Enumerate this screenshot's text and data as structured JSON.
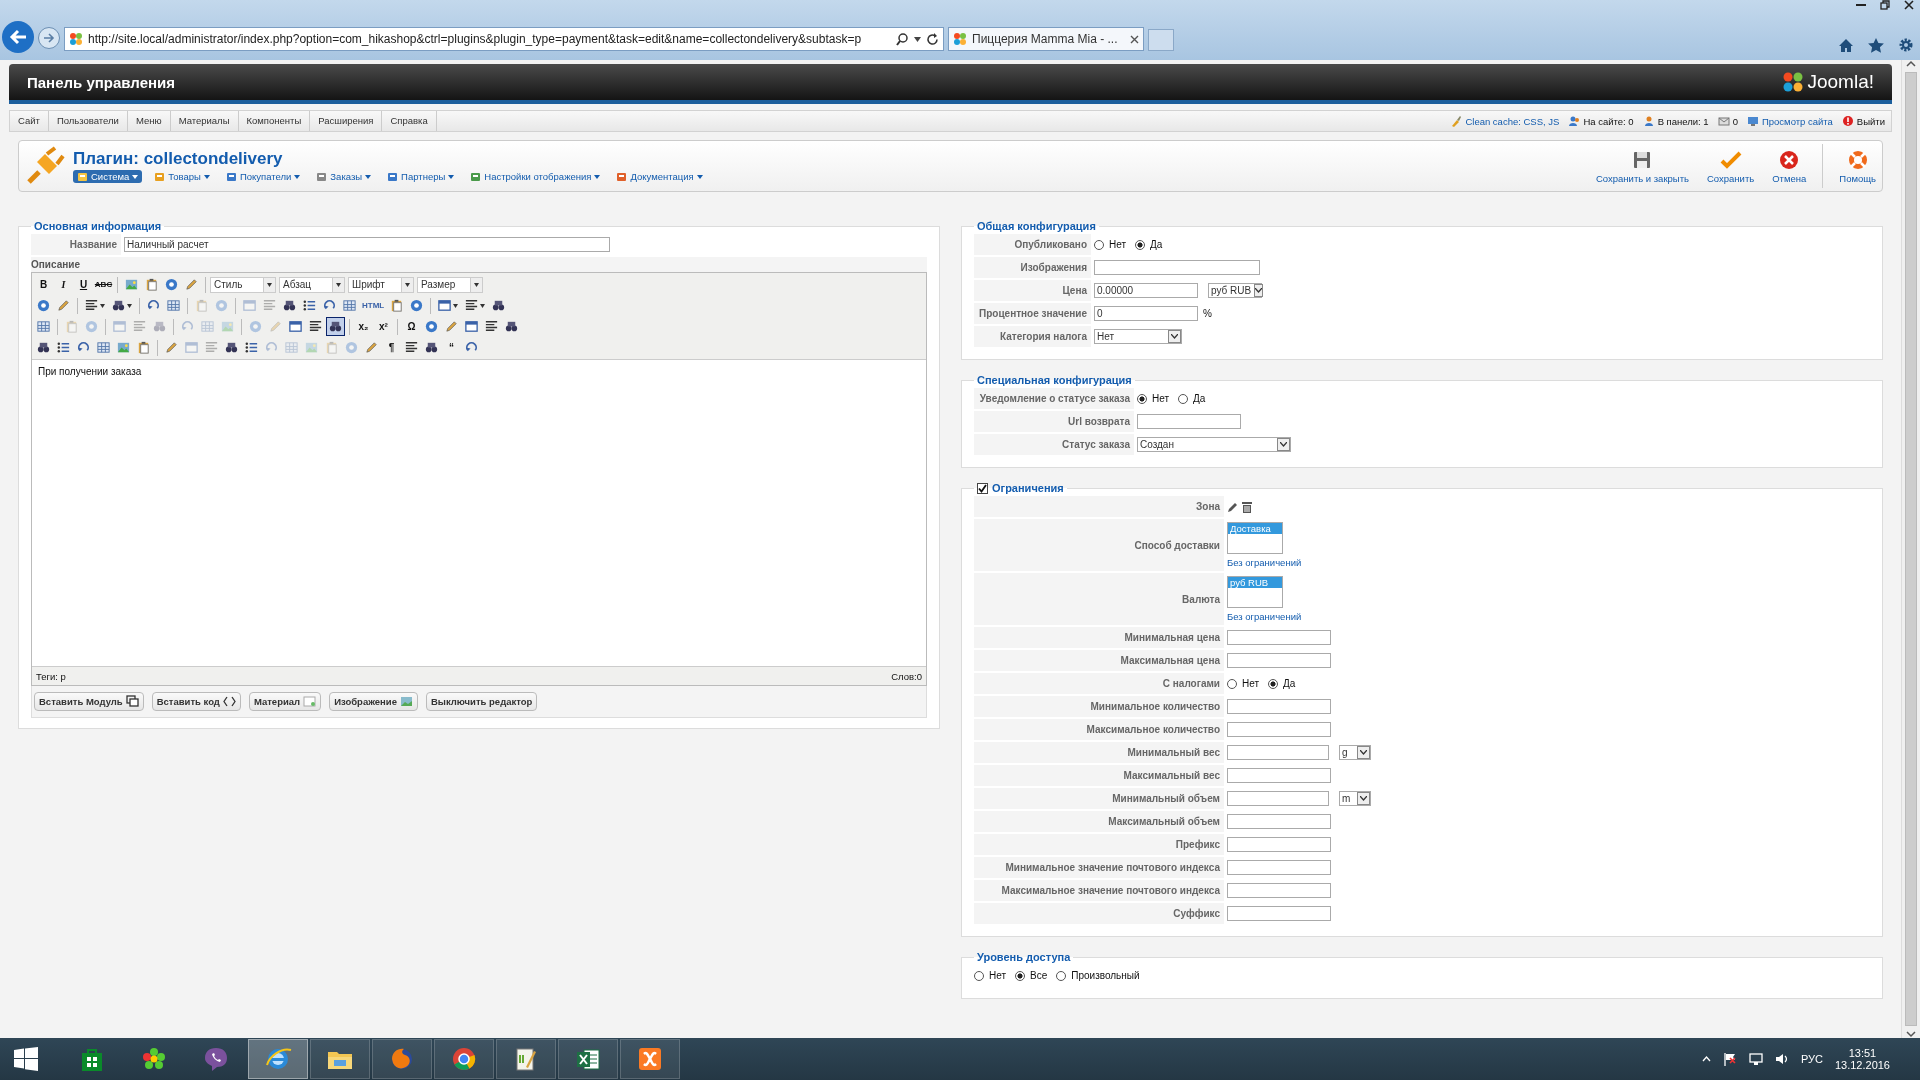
{
  "browser": {
    "url": "http://site.local/administrator/index.php?option=com_hikashop&ctrl=plugins&plugin_type=payment&task=edit&name=collectondelivery&subtask=p",
    "tabs": [
      {
        "title": "Пиццерия Mamma Mia - ...",
        "selected": true
      }
    ]
  },
  "header": {
    "title": "Панель управления",
    "logo": "Joomla!"
  },
  "menu": [
    "Сайт",
    "Пользователи",
    "Меню",
    "Материалы",
    "Компоненты",
    "Расширения",
    "Справка"
  ],
  "status_links": [
    {
      "kind": "cache",
      "label": "Clean cache: CSS, JS"
    },
    {
      "kind": "visitors",
      "label": "На сайте: 0"
    },
    {
      "kind": "admins",
      "label": "В панели: 1"
    },
    {
      "kind": "messages",
      "label": "0"
    },
    {
      "kind": "preview",
      "label": "Просмотр сайта"
    },
    {
      "kind": "logout",
      "label": "Выйти"
    }
  ],
  "toolbar": {
    "title": "Плагин: collectondelivery",
    "submenu": [
      {
        "label": "Система",
        "selected": true
      },
      {
        "label": "Товары",
        "selected": false
      },
      {
        "label": "Покупатели",
        "selected": false
      },
      {
        "label": "Заказы",
        "selected": false
      },
      {
        "label": "Партнеры",
        "selected": false
      },
      {
        "label": "Настройки отображения",
        "selected": false
      },
      {
        "label": "Документация",
        "selected": false
      }
    ],
    "buttons": [
      {
        "kind": "save_close",
        "label": "Сохранить и закрыть"
      },
      {
        "kind": "save",
        "label": "Сохранить"
      },
      {
        "kind": "cancel",
        "label": "Отмена"
      },
      {
        "kind": "help",
        "label": "Помощь"
      }
    ]
  },
  "basic": {
    "legend": "Основная информация",
    "name_label": "Название",
    "name_value": "Наличный расчет",
    "description_label": "Описание",
    "editor": {
      "tool_lines": [
        [
          {
            "kind": "bold",
            "text": "B"
          },
          {
            "kind": "italic",
            "text": "I"
          },
          {
            "kind": "underline",
            "text": "U"
          },
          {
            "kind": "strike",
            "text": "ABC"
          },
          {
            "kind": "sep"
          },
          {
            "kind": "icon",
            "disabled": false,
            "active": false
          },
          {
            "kind": "icon",
            "disabled": false,
            "active": false
          },
          {
            "kind": "icon",
            "disabled": false,
            "active": false
          },
          {
            "kind": "icon",
            "disabled": false,
            "active": false
          },
          {
            "kind": "sep"
          },
          {
            "kind": "select",
            "label": "Стиль"
          },
          {
            "kind": "select",
            "label": "Абзац"
          },
          {
            "kind": "select",
            "label": "Шрифт"
          },
          {
            "kind": "select",
            "label": "Размер"
          }
        ],
        [
          {
            "kind": "icon",
            "disabled": false,
            "active": false
          },
          {
            "kind": "icon",
            "disabled": false,
            "active": false
          },
          {
            "kind": "sep"
          },
          {
            "kind": "icon_menu",
            "disabled": false,
            "active": false
          },
          {
            "kind": "icon_menu",
            "disabled": false,
            "active": false
          },
          {
            "kind": "sep"
          },
          {
            "kind": "icon",
            "disabled": false,
            "active": false
          },
          {
            "kind": "icon",
            "disabled": false,
            "active": false
          },
          {
            "kind": "sep"
          },
          {
            "kind": "icon",
            "disabled": true,
            "active": false
          },
          {
            "kind": "icon",
            "disabled": true,
            "active": false
          },
          {
            "kind": "sep"
          },
          {
            "kind": "icon",
            "disabled": true,
            "active": false
          },
          {
            "kind": "icon",
            "disabled": true,
            "active": false
          },
          {
            "kind": "icon",
            "disabled": false,
            "active": false
          },
          {
            "kind": "icon",
            "disabled": false,
            "active": false
          },
          {
            "kind": "icon",
            "disabled": false,
            "active": false
          },
          {
            "kind": "icon",
            "disabled": false,
            "active": false
          },
          {
            "kind": "small",
            "text": "HTML"
          },
          {
            "kind": "icon",
            "disabled": false,
            "active": false
          },
          {
            "kind": "icon",
            "disabled": false,
            "active": false
          },
          {
            "kind": "sep"
          },
          {
            "kind": "icon_menu",
            "disabled": false,
            "active": false
          },
          {
            "kind": "icon_menu",
            "disabled": false,
            "active": false
          },
          {
            "kind": "icon",
            "disabled": false,
            "active": false
          }
        ],
        [
          {
            "kind": "icon",
            "disabled": false,
            "active": false
          },
          {
            "kind": "sep"
          },
          {
            "kind": "icon",
            "disabled": true,
            "active": false
          },
          {
            "kind": "icon",
            "disabled": true,
            "active": false
          },
          {
            "kind": "sep"
          },
          {
            "kind": "icon",
            "disabled": true,
            "active": false
          },
          {
            "kind": "icon",
            "disabled": true,
            "active": false
          },
          {
            "kind": "icon",
            "disabled": true,
            "active": false
          },
          {
            "kind": "sep"
          },
          {
            "kind": "icon",
            "disabled": true,
            "active": false
          },
          {
            "kind": "icon",
            "disabled": true,
            "active": false
          },
          {
            "kind": "icon",
            "disabled": true,
            "active": false
          },
          {
            "kind": "sep"
          },
          {
            "kind": "icon",
            "disabled": true,
            "active": false
          },
          {
            "kind": "icon",
            "disabled": true,
            "active": false
          },
          {
            "kind": "icon",
            "disabled": false,
            "active": false
          },
          {
            "kind": "icon",
            "disabled": false,
            "active": false
          },
          {
            "kind": "icon",
            "disabled": false,
            "active": true
          },
          {
            "kind": "sep"
          },
          {
            "kind": "glyph",
            "text": "x₂"
          },
          {
            "kind": "glyph",
            "text": "x²"
          },
          {
            "kind": "sep"
          },
          {
            "kind": "glyph",
            "text": "Ω"
          },
          {
            "kind": "icon",
            "disabled": false,
            "active": false
          },
          {
            "kind": "icon",
            "disabled": false,
            "active": false
          },
          {
            "kind": "icon",
            "disabled": false,
            "active": false
          },
          {
            "kind": "icon",
            "disabled": false,
            "active": false
          },
          {
            "kind": "icon",
            "disabled": false,
            "active": false
          }
        ],
        [
          {
            "kind": "icon",
            "disabled": false,
            "active": false
          },
          {
            "kind": "icon",
            "disabled": false,
            "active": false
          },
          {
            "kind": "icon",
            "disabled": false,
            "active": false
          },
          {
            "kind": "icon",
            "disabled": false,
            "active": false
          },
          {
            "kind": "icon",
            "disabled": false,
            "active": false
          },
          {
            "kind": "icon",
            "disabled": false,
            "active": false
          },
          {
            "kind": "sep"
          },
          {
            "kind": "icon",
            "disabled": false,
            "active": false
          },
          {
            "kind": "icon",
            "disabled": true,
            "active": false
          },
          {
            "kind": "icon",
            "disabled": true,
            "active": false
          },
          {
            "kind": "icon",
            "disabled": false,
            "active": false
          },
          {
            "kind": "icon",
            "disabled": false,
            "active": false
          },
          {
            "kind": "icon",
            "disabled": true,
            "active": false
          },
          {
            "kind": "icon",
            "disabled": true,
            "active": false
          },
          {
            "kind": "icon",
            "disabled": true,
            "active": false
          },
          {
            "kind": "icon",
            "disabled": true,
            "active": false
          },
          {
            "kind": "icon",
            "disabled": true,
            "active": false
          },
          {
            "kind": "icon",
            "disabled": false,
            "active": false
          },
          {
            "kind": "glyph",
            "text": "¶"
          },
          {
            "kind": "icon",
            "disabled": false,
            "active": false
          },
          {
            "kind": "icon",
            "disabled": false,
            "active": false
          },
          {
            "kind": "glyph",
            "text": "“"
          },
          {
            "kind": "icon",
            "disabled": false,
            "active": false
          }
        ]
      ],
      "content": "При получении заказа",
      "tags": "Теги: p",
      "words": "Слов:0"
    },
    "buttons": [
      {
        "kind": "module",
        "label": "Вставить Модуль"
      },
      {
        "kind": "code",
        "label": "Вставить код"
      },
      {
        "kind": "article",
        "label": "Материал"
      },
      {
        "kind": "image",
        "label": "Изображение"
      },
      {
        "kind": "plain",
        "label": "Выключить редактор"
      }
    ]
  },
  "sections": [
    {
      "kind": "general",
      "legend": "Общая конфигурация",
      "fields": [
        {
          "label": "Опубликовано",
          "kind": "radio",
          "options": [
            {
              "label": "Нет",
              "selected": false
            },
            {
              "label": "Да",
              "selected": true
            }
          ]
        },
        {
          "label": "Изображения",
          "kind": "input"
        },
        {
          "label": "Цена",
          "kind": "input_select",
          "value": "0.00000",
          "select": "руб RUB"
        },
        {
          "label": "Процентное значение",
          "kind": "input_suffix",
          "value": "0",
          "suffix": "%"
        },
        {
          "label": "Категория налога",
          "kind": "select",
          "value": "Нет"
        }
      ]
    },
    {
      "kind": "special",
      "legend": "Специальная конфигурация",
      "fields": [
        {
          "label": "Уведомление о статусе заказа",
          "kind": "radio",
          "options": [
            {
              "label": "Нет",
              "selected": true
            },
            {
              "label": "Да",
              "selected": false
            }
          ]
        },
        {
          "label": "Url возврата",
          "kind": "input"
        },
        {
          "label": "Статус заказа",
          "kind": "select",
          "value": "Создан"
        }
      ]
    },
    {
      "kind": "restrictions",
      "legend": "Ограничения",
      "checked": true,
      "fields": [
        {
          "label": "Зона",
          "kind": "icons"
        },
        {
          "label": "Способ доставки",
          "kind": "listbox",
          "options": [
            {
              "label": "Доставка",
              "selected": true
            }
          ],
          "link": "Без ограничений"
        },
        {
          "label": "Валюта",
          "kind": "listbox",
          "options": [
            {
              "label": "руб RUB",
              "selected": true
            }
          ],
          "link": "Без ограничений"
        },
        {
          "label": "Минимальная цена",
          "kind": "input"
        },
        {
          "label": "Максимальная цена",
          "kind": "input"
        },
        {
          "label": "С налогами",
          "kind": "radio",
          "options": [
            {
              "label": "Нет",
              "selected": false
            },
            {
              "label": "Да",
              "selected": true
            }
          ]
        },
        {
          "label": "Минимальное количество",
          "kind": "input"
        },
        {
          "label": "Максимальное количество",
          "kind": "input"
        },
        {
          "label": "Минимальный вес",
          "kind": "input_select",
          "select": "g"
        },
        {
          "label": "Максимальный вес",
          "kind": "input"
        },
        {
          "label": "Минимальный объем",
          "kind": "input_select",
          "select": "m"
        },
        {
          "label": "Максимальный объем",
          "kind": "input"
        },
        {
          "label": "Префикс",
          "kind": "input"
        },
        {
          "label": "Минимальное значение почтового индекса",
          "kind": "input"
        },
        {
          "label": "Максимальное значение почтового индекса",
          "kind": "input"
        },
        {
          "label": "Суффикс",
          "kind": "input"
        }
      ]
    }
  ],
  "access": {
    "legend": "Уровень доступа",
    "options": [
      {
        "label": "Нет",
        "selected": false
      },
      {
        "label": "Все",
        "selected": true
      },
      {
        "label": "Произвольный",
        "selected": false
      }
    ]
  },
  "taskbar": {
    "apps": [
      {
        "kind": "store",
        "selected": false
      },
      {
        "kind": "flower",
        "selected": false
      },
      {
        "kind": "chat",
        "selected": false
      },
      {
        "kind": "ie",
        "selected": true
      },
      {
        "kind": "folder",
        "selected": false
      },
      {
        "kind": "fox",
        "selected": false
      },
      {
        "kind": "ring",
        "selected": false
      },
      {
        "kind": "notepad",
        "selected": false
      },
      {
        "kind": "sheet",
        "selected": false
      },
      {
        "kind": "xampp",
        "selected": false
      }
    ],
    "language": "РУС",
    "time": "13:51",
    "date": "13.12.2016"
  }
}
